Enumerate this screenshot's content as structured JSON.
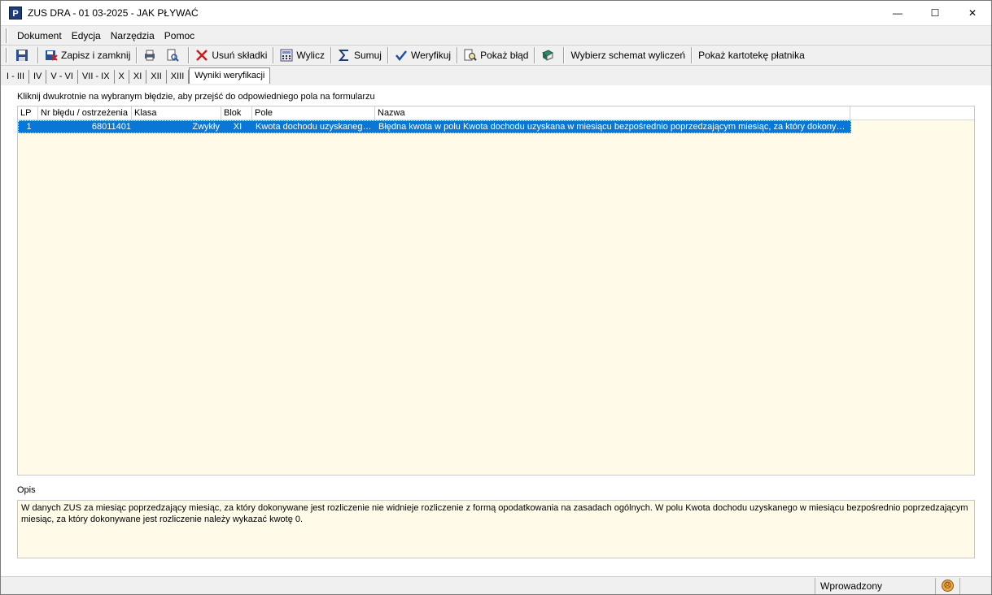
{
  "window": {
    "title": "ZUS DRA - 01 03-2025 - JAK PŁYWAĆ",
    "app_icon_letter": "P",
    "min_glyph": "—",
    "max_glyph": "☐",
    "close_glyph": "✕"
  },
  "menu": [
    "Dokument",
    "Edycja",
    "Narzędzia",
    "Pomoc"
  ],
  "toolbar": {
    "save_and_close": "Zapisz i zamknij",
    "remove_contributions": "Usuń składki",
    "calculate": "Wylicz",
    "sum": "Sumuj",
    "verify": "Weryfikuj",
    "show_error": "Pokaż błąd",
    "choose_scheme": "Wybierz schemat wyliczeń",
    "show_payer_card": "Pokaż kartotekę płatnika"
  },
  "tabs": [
    "I - III",
    "IV",
    "V - VI",
    "VII - IX",
    "X",
    "XI",
    "XII",
    "XIII",
    "Wyniki weryfikacji"
  ],
  "hint": "Kliknij dwukrotnie na wybranym błędzie, aby przejść do odpowiedniego pola na formularzu",
  "grid": {
    "columns": [
      "LP",
      "Nr błędu / ostrzeżenia",
      "Klasa",
      "Blok",
      "Pole",
      "Nazwa"
    ],
    "rows": [
      {
        "lp": "1",
        "nr": "68011401",
        "klasa": "Zwykły",
        "blok": "XI",
        "pole": "Kwota dochodu uzyskanego ...",
        "nazwa": "Błędna kwota w polu Kwota dochodu uzyskana w miesiącu bezpośrednio poprzedzającym miesiąc, za który dokonywane..."
      }
    ]
  },
  "opis": {
    "label": "Opis",
    "text": "W danych ZUS za miesiąc poprzedzający miesiąc, za który dokonywane jest rozliczenie nie widnieje rozliczenie z formą opodatkowania na zasadach ogólnych. W polu Kwota dochodu uzyskanego w miesiącu bezpośrednio poprzedzającym miesiąc, za który dokonywane jest rozliczenie należy wykazać kwotę 0."
  },
  "status": {
    "state": "Wprowadzony"
  },
  "colors": {
    "selection": "#0a76d6",
    "grid_bg": "#fffbe8"
  }
}
